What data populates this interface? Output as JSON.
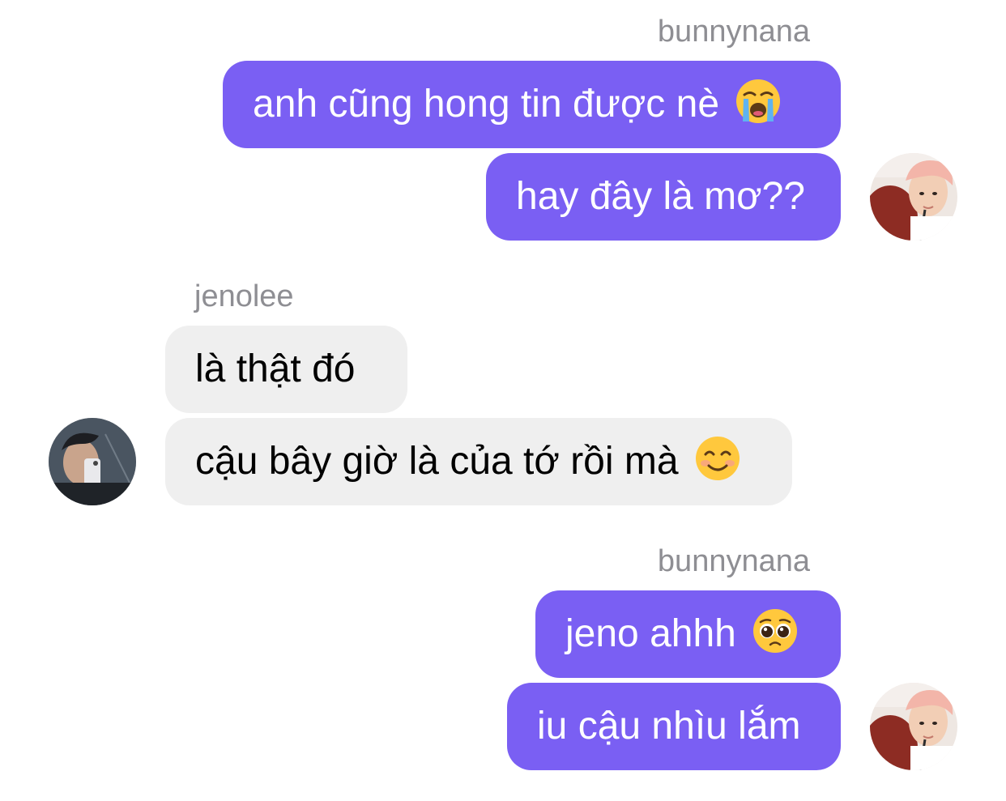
{
  "groups": [
    {
      "sender": "bunnynana",
      "messages": [
        {
          "text": "anh cũng hong tin được nè",
          "emoji": "loudly-crying-face-icon"
        },
        {
          "text": "hay đây là mơ??",
          "emoji": null
        }
      ]
    },
    {
      "sender": "jenolee",
      "messages": [
        {
          "text": "là thật đó",
          "emoji": null
        },
        {
          "text": "cậu bây giờ là của tớ rồi mà",
          "emoji": "smiling-face-icon"
        }
      ]
    },
    {
      "sender": "bunnynana",
      "messages": [
        {
          "text": "jeno ahhh",
          "emoji": "pleading-face-icon"
        },
        {
          "text": "iu cậu nhìu lắm",
          "emoji": null
        }
      ]
    }
  ],
  "colors": {
    "outgoing_bubble": "#7a5ff3",
    "incoming_bubble": "#efefef",
    "sender_label": "#8e8e93"
  }
}
